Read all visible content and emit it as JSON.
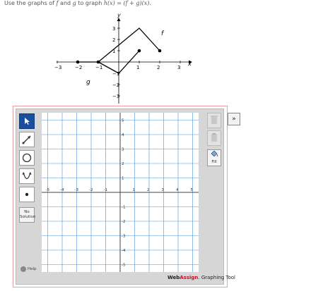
{
  "problem": {
    "prefix": "Use the graphs of ",
    "f": "f",
    "mid1": " and ",
    "g": "g",
    "mid2": " to graph ",
    "formula": "h(x) = (f + g)(x)."
  },
  "fg_graph": {
    "axis_x_label": "x",
    "axis_y_label": "y",
    "x_ticks": [
      "−3",
      "−2",
      "−1",
      "1",
      "2",
      "3"
    ],
    "y_ticks": [
      "3",
      "2",
      "1",
      "−1",
      "−2",
      "−3"
    ],
    "f_label": "f",
    "g_label": "g",
    "f_points": [
      [
        -2,
        0
      ],
      [
        -1,
        0
      ],
      [
        1,
        3
      ],
      [
        2,
        1
      ]
    ],
    "g_points": [
      [
        -1,
        0
      ],
      [
        0,
        -1
      ],
      [
        1,
        1
      ]
    ],
    "line_color": "#000000"
  },
  "tool": {
    "no_solution": "No Solution",
    "help": "Help",
    "fill": "Fill",
    "brand_web": "Web",
    "brand_assign": "Assign",
    "brand_rest": ". Graphing Tool",
    "expand": "»",
    "grid_x_ticks": [
      "-5",
      "-4",
      "-3",
      "-2",
      "-1",
      "1",
      "2",
      "3",
      "4",
      "5"
    ],
    "grid_y_ticks": [
      "5",
      "4",
      "3",
      "2",
      "1",
      "-1",
      "-2",
      "-3",
      "-4",
      "-5"
    ],
    "grid_color": "#4a90d9",
    "accent_color": "#1a4fa0",
    "brand_color": "#c8102e"
  }
}
